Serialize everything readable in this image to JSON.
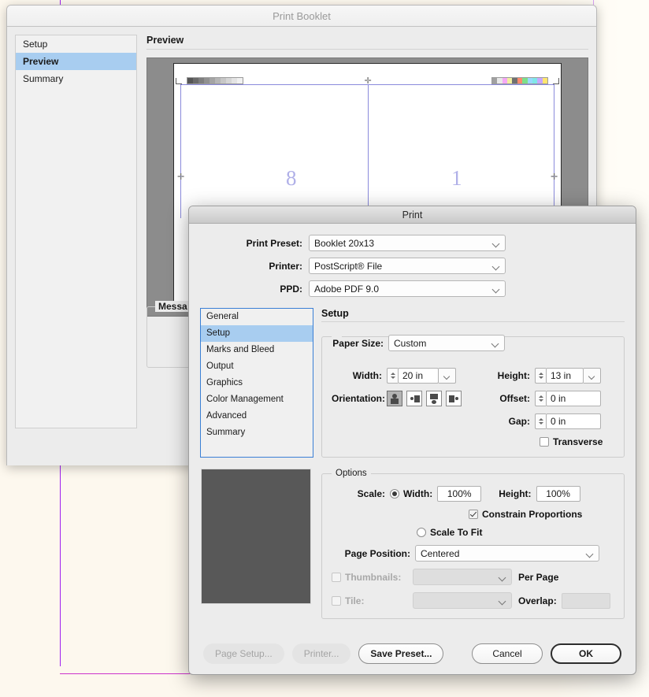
{
  "desktop": {
    "background_color": "#fdf8ee",
    "guide_color": "#a020f0"
  },
  "print_booklet_window": {
    "title": "Print Booklet",
    "sidebar": {
      "items": [
        {
          "label": "Setup",
          "selected": false
        },
        {
          "label": "Preview",
          "selected": true
        },
        {
          "label": "Summary",
          "selected": false
        }
      ]
    },
    "main": {
      "section_title": "Preview",
      "spread": {
        "left_page_number": "8",
        "right_page_number": "1",
        "page_number_color": "#b0b0e8",
        "bound_color": "#8a8adc",
        "canvas_color": "#8c8c8c",
        "sheet_color": "#ffffff"
      },
      "color_bar_swatches": [
        "#a0a0a0",
        "#e8e8e8",
        "#f5a8f5",
        "#f0f0a0",
        "#707070",
        "#ff8a6e",
        "#7de08a",
        "#9ad8ff",
        "#7fe8e8",
        "#c8a8ff",
        "#ffe66e"
      ],
      "messages_group_label": "Messa"
    }
  },
  "print_dialog": {
    "title": "Print",
    "top_fields": [
      {
        "label": "Print Preset:",
        "value": "Booklet 20x13",
        "name": "print-preset"
      },
      {
        "label": "Printer:",
        "value": "PostScript® File",
        "name": "printer"
      },
      {
        "label": "PPD:",
        "value": "Adobe PDF 9.0",
        "name": "ppd"
      }
    ],
    "nav": {
      "items": [
        {
          "label": "General",
          "selected": false
        },
        {
          "label": "Setup",
          "selected": true
        },
        {
          "label": "Marks and Bleed",
          "selected": false
        },
        {
          "label": "Output",
          "selected": false
        },
        {
          "label": "Graphics",
          "selected": false
        },
        {
          "label": "Color Management",
          "selected": false
        },
        {
          "label": "Advanced",
          "selected": false
        },
        {
          "label": "Summary",
          "selected": false
        }
      ],
      "focus_ring_color": "#3a7fd5"
    },
    "panel": {
      "title": "Setup",
      "paper_size_group": {
        "paper_size_label": "Paper Size:",
        "paper_size_value": "Custom",
        "width_label": "Width:",
        "width_value": "20 in",
        "height_label": "Height:",
        "height_value": "13 in",
        "offset_label": "Offset:",
        "offset_value": "0 in",
        "gap_label": "Gap:",
        "gap_value": "0 in",
        "orientation_label": "Orientation:",
        "orientation_options": [
          {
            "name": "portrait",
            "selected": true
          },
          {
            "name": "landscape",
            "selected": false
          },
          {
            "name": "reverse-portrait",
            "selected": false
          },
          {
            "name": "reverse-landscape",
            "selected": false
          }
        ],
        "transverse_label": "Transverse",
        "transverse_checked": false
      },
      "options_group": {
        "legend": "Options",
        "scale_label": "Scale:",
        "scale_mode": "width-height",
        "width_label": "Width:",
        "width_value": "100%",
        "height_label": "Height:",
        "height_value": "100%",
        "constrain_label": "Constrain Proportions",
        "constrain_checked": true,
        "scale_to_fit_label": "Scale To Fit",
        "scale_to_fit_selected": false,
        "page_position_label": "Page Position:",
        "page_position_value": "Centered",
        "thumbnails_label": "Thumbnails:",
        "thumbnails_checked": false,
        "thumbnails_value": "",
        "per_page_label": "Per Page",
        "tile_label": "Tile:",
        "tile_checked": false,
        "tile_value": "",
        "overlap_label": "Overlap:",
        "overlap_value": ""
      }
    },
    "buttons": [
      {
        "label": "Page Setup...",
        "name": "page-setup-button",
        "style": "flat",
        "enabled": false
      },
      {
        "label": "Printer...",
        "name": "printer-button",
        "style": "flat",
        "enabled": false
      },
      {
        "label": "Save Preset...",
        "name": "save-preset-button",
        "style": "bold",
        "enabled": true
      },
      {
        "label": "Cancel",
        "name": "cancel-button",
        "style": "normal",
        "enabled": true
      },
      {
        "label": "OK",
        "name": "ok-button",
        "style": "default",
        "enabled": true
      }
    ]
  }
}
